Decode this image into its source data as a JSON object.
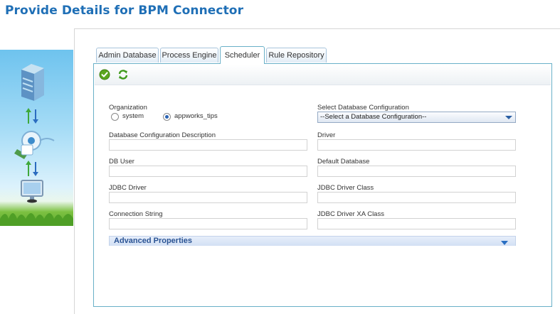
{
  "page": {
    "title": "Provide Details for BPM Connector"
  },
  "tabs": [
    {
      "label": "Admin Database",
      "active": false
    },
    {
      "label": "Process Engine",
      "active": false
    },
    {
      "label": "Scheduler",
      "active": true
    },
    {
      "label": "Rule Repository",
      "active": false
    }
  ],
  "toolbar": {
    "save_icon": "check-icon",
    "refresh_icon": "refresh-icon"
  },
  "form": {
    "organization": {
      "label": "Organization",
      "options": [
        "system",
        "appworks_tips"
      ],
      "selected": "appworks_tips"
    },
    "db_config": {
      "label": "Select Database Configuration",
      "value": "--Select a Database Configuration--"
    },
    "fields": [
      {
        "label": "Database Configuration Description",
        "value": ""
      },
      {
        "label": "Driver",
        "value": ""
      },
      {
        "label": "DB User",
        "value": ""
      },
      {
        "label": "Default Database",
        "value": ""
      },
      {
        "label": "JDBC Driver",
        "value": ""
      },
      {
        "label": "JDBC Driver Class",
        "value": ""
      },
      {
        "label": "Connection String",
        "value": ""
      },
      {
        "label": "JDBC Driver XA Class",
        "value": ""
      }
    ],
    "advanced": {
      "label": "Advanced Properties"
    }
  },
  "colors": {
    "title": "#1f6fb6",
    "frame_border": "#69b0c8",
    "accent_green": "#5ba61e"
  }
}
